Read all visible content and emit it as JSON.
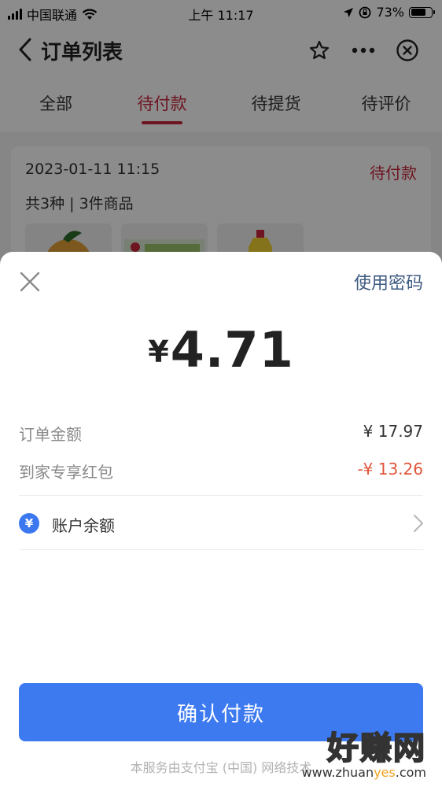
{
  "status_bar": {
    "carrier": "中国联通",
    "time": "上午 11:17",
    "battery": "73%",
    "battery_level": 0.73
  },
  "nav": {
    "title": "订单列表"
  },
  "tabs": [
    {
      "label": "全部",
      "active": false
    },
    {
      "label": "待付款",
      "active": true
    },
    {
      "label": "待提货",
      "active": false
    },
    {
      "label": "待评价",
      "active": false
    }
  ],
  "order": {
    "date": "2023-01-11 11:15",
    "status": "待付款",
    "count": "共3种 | 3件商品"
  },
  "payment": {
    "use_password": "使用密码",
    "currency_symbol": "¥",
    "amount": "4.71",
    "order_amount_label": "订单金额",
    "order_amount_value": "¥ 17.97",
    "red_packet_label": "到家专享红包",
    "red_packet_value": "-¥ 13.26",
    "balance_icon_text": "¥",
    "balance_label": "账户余额",
    "confirm_label": "确认付款",
    "service_note": "本服务由支付宝 (中国) 网络技术"
  },
  "watermark": {
    "text": "好赚网",
    "url_prefix": "www.zhuan",
    "url_highlight": "yes",
    "url_suffix": ".com"
  },
  "colors": {
    "accent_red": "#c8273c",
    "primary_blue": "#3d7af0",
    "discount_red": "#e0553a",
    "link_blue": "#3d5a80"
  }
}
